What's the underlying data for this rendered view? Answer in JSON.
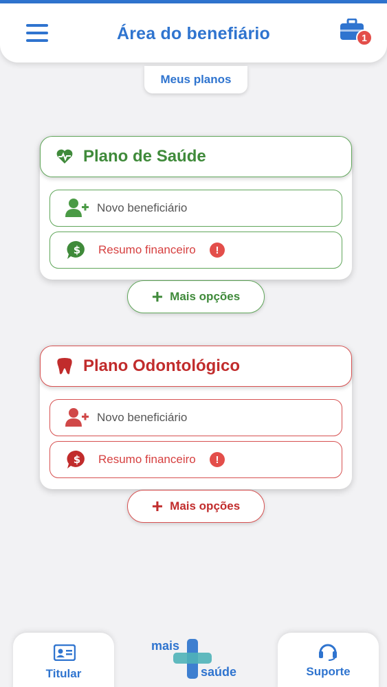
{
  "header": {
    "title": "Área do benefiário",
    "cart_badge": "1"
  },
  "tabs": {
    "meus_planos": "Meus planos"
  },
  "cards": [
    {
      "title": "Plano de Saúde",
      "color": "#3f8a3a",
      "rows": [
        {
          "label": "Novo beneficiário"
        },
        {
          "label": "Resumo financeiro",
          "alert": "!"
        }
      ],
      "more_label": "Mais opções"
    },
    {
      "title": "Plano Odontológico",
      "color": "#c12c2c",
      "rows": [
        {
          "label": "Novo beneficiário"
        },
        {
          "label": "Resumo financeiro",
          "alert": "!"
        }
      ],
      "more_label": "Mais opções"
    }
  ],
  "bottom_nav": {
    "titular": "Titular",
    "suporte": "Suporte",
    "logo_top": "mais",
    "logo_bottom": "saúde"
  },
  "colors": {
    "primary": "#2f74cf",
    "alert": "#e34e4a"
  }
}
